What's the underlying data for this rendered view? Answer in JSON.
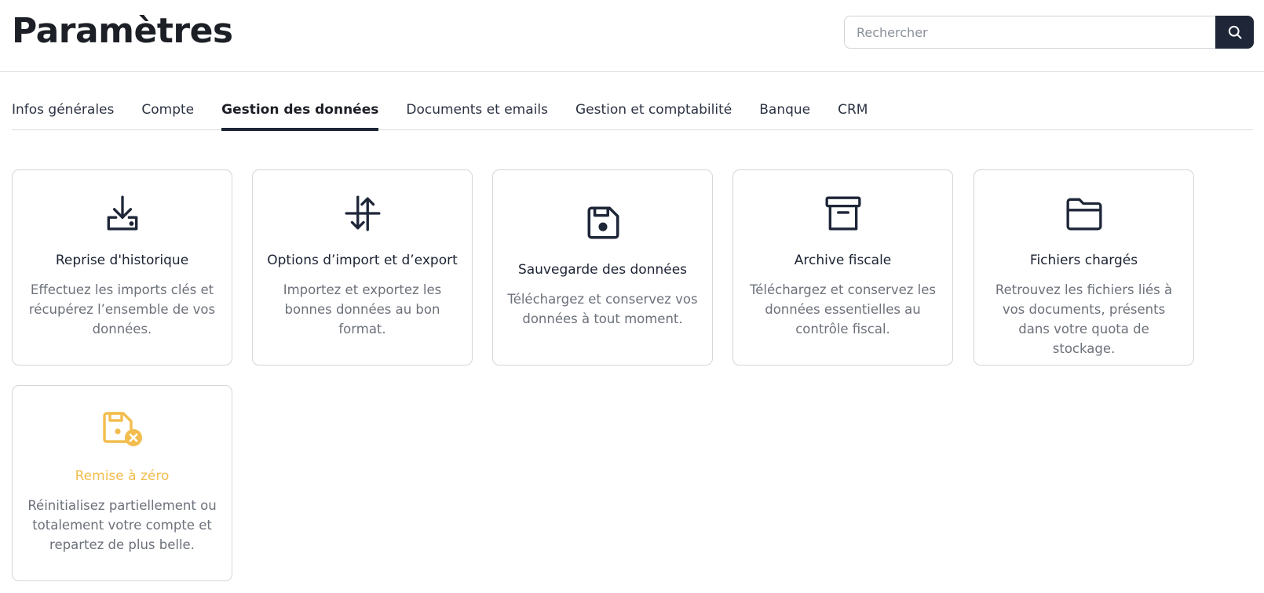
{
  "header": {
    "title": "Paramètres",
    "search_placeholder": "Rechercher",
    "search_icon": "search-icon"
  },
  "tabs": [
    {
      "label": "Infos générales",
      "active": false
    },
    {
      "label": "Compte",
      "active": false
    },
    {
      "label": "Gestion des données",
      "active": true
    },
    {
      "label": "Documents et emails",
      "active": false
    },
    {
      "label": "Gestion et comptabilité",
      "active": false
    },
    {
      "label": "Banque",
      "active": false
    },
    {
      "label": "CRM",
      "active": false
    }
  ],
  "cards": [
    {
      "title": "Reprise d'historique",
      "description": "Effectuez les imports clés et récupérez l’ensemble de vos données.",
      "icon": "download-tray-icon"
    },
    {
      "title": "Options d’import et d’export",
      "description": "Importez et exportez les bonnes données au bon format.",
      "icon": "import-export-arrows-icon"
    },
    {
      "title": "Sauvegarde des données",
      "description": "Téléchargez et conservez vos données à tout moment.",
      "icon": "floppy-disk-icon"
    },
    {
      "title": "Archive fiscale",
      "description": "Téléchargez et conservez les données essentielles au contrôle fiscal.",
      "icon": "archive-box-icon"
    },
    {
      "title": "Fichiers chargés",
      "description": "Retrouvez les fichiers liés à vos documents, présents dans votre quota de stockage.",
      "icon": "folder-icon"
    },
    {
      "title": "Remise à zéro",
      "description": "Réinitialisez partiellement ou totalement votre compte et repartez de plus belle.",
      "icon": "floppy-disk-reset-icon"
    }
  ],
  "colors": {
    "primary": "#1e2638",
    "warning": "#f2bd4e",
    "muted_text": "#6c717a",
    "border": "#d3d6db"
  }
}
